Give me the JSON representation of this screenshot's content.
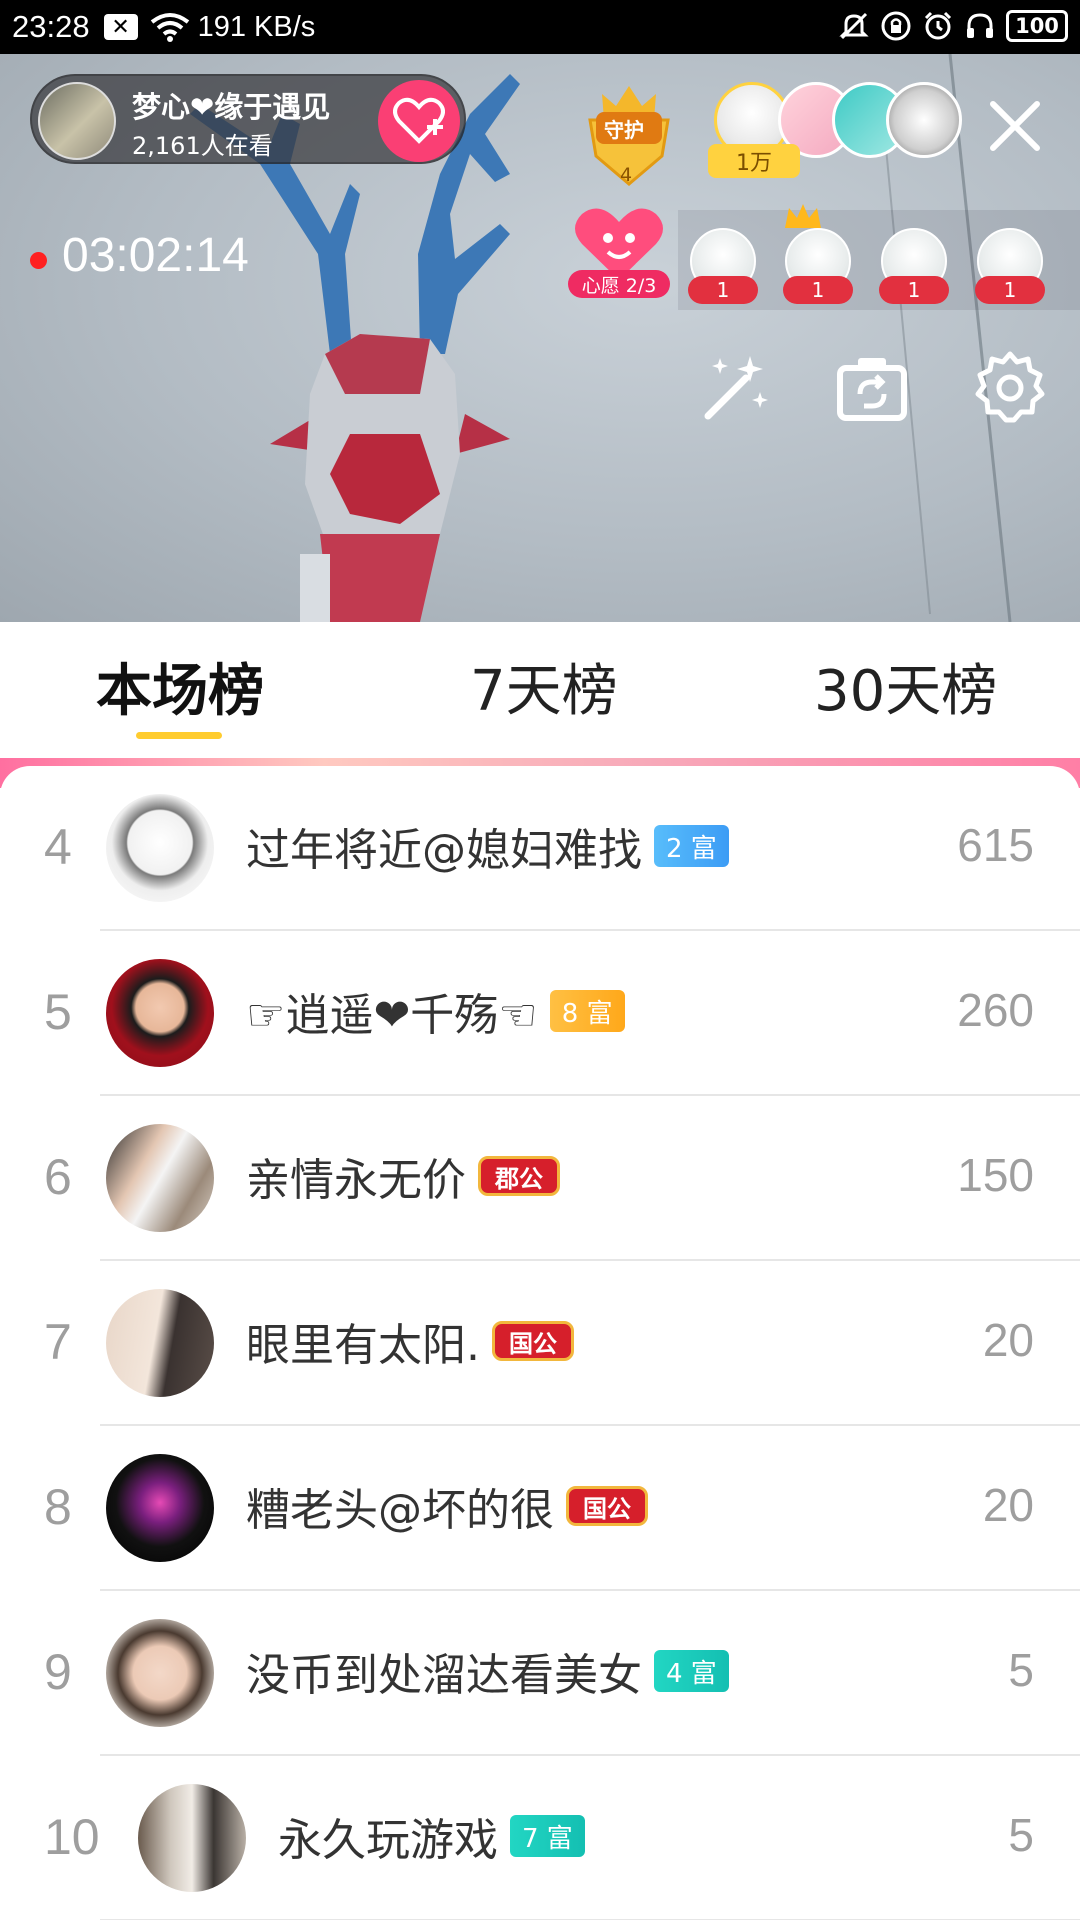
{
  "status_bar": {
    "time": "23:28",
    "net_speed": "191 KB/s",
    "battery": "100",
    "icons": [
      "close-notification-icon",
      "wifi-icon",
      "mute-icon",
      "rotation-lock-icon",
      "alarm-icon",
      "headphones-icon",
      "battery-icon"
    ]
  },
  "live": {
    "host_name": "梦心❤缘于遇见",
    "viewer_count": "2,161人在看",
    "guard_label": "守护",
    "guard_count": "4",
    "top_rank_value": "1万",
    "elapsed_time": "03:02:14",
    "wish_label": "心愿 2/3",
    "viewer_badges": [
      "1",
      "1",
      "1",
      "1"
    ],
    "tools": [
      "magic-wand-icon",
      "flip-camera-icon",
      "settings-icon"
    ]
  },
  "tabs": [
    {
      "label": "本场榜",
      "active": true
    },
    {
      "label": "7天榜",
      "active": false
    },
    {
      "label": "30天榜",
      "active": false
    }
  ],
  "rankings": [
    {
      "rank": "4",
      "name": "过年将近@媳妇难找",
      "badge": "2 富",
      "badge_style": "blue",
      "score": "615"
    },
    {
      "rank": "5",
      "name": "☞逍遥❤千殇☜",
      "badge": "8 富",
      "badge_style": "orange",
      "score": "260"
    },
    {
      "rank": "6",
      "name": "亲情永无价",
      "badge": "郡公",
      "badge_style": "royal",
      "score": "150"
    },
    {
      "rank": "7",
      "name": "眼里有太阳.",
      "badge": "国公",
      "badge_style": "royal",
      "score": "20"
    },
    {
      "rank": "8",
      "name": "糟老头@坏的很",
      "badge": "国公",
      "badge_style": "royal",
      "score": "20"
    },
    {
      "rank": "9",
      "name": "没币到处溜达看美女",
      "badge": "4 富",
      "badge_style": "teal",
      "score": "5"
    },
    {
      "rank": "10",
      "name": "永久玩游戏",
      "badge": "7 富",
      "badge_style": "teal",
      "score": "5"
    }
  ],
  "colors": {
    "accent_pink": "#fa3f74",
    "tab_underline": "#ffcc2f",
    "rank_text": "#9e9e9e"
  }
}
